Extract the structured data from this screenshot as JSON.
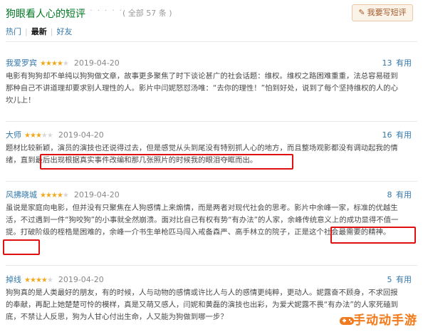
{
  "header": {
    "title": "狗眼看人心的短评",
    "dots": "· · · · · ·",
    "count": "( 全部 57 条 )",
    "write_label": "我要写短评",
    "pencil_icon": "pencil-icon"
  },
  "tabs": [
    {
      "label": "热门",
      "active": false
    },
    {
      "label": "最新",
      "active": true
    },
    {
      "label": "好友",
      "active": false
    }
  ],
  "star_color": "#f0a91b",
  "reviews": [
    {
      "user": "我爱罗宾",
      "rating": 4,
      "date": "2019-04-20",
      "votes": "13",
      "useful_label": "有用",
      "text": "电影有狗狗却不单纯以狗狗做文章，故事更多聚焦了时下谈论甚广的社会话题：维权。维权之路困难重重，法总容易碰到那种自己不讲道理却要求别人理性的人。影片中闫妮怒怼汤唯：“去你的理性！”怕到好处，说到了每个坚持维权的人的心坎儿上！"
    },
    {
      "user": "大师",
      "rating": 3,
      "date": "2019-04-20",
      "votes": "16",
      "useful_label": "有用",
      "text": "题材比较新颖，演员的演技也还说得过去，但是感觉从头到尾没有特别抓人心的地方，而且整场观影都没有调动起我的情绪，直到最后出现根据真实事件改编和那几张照片的时候我的眼泪夺眶而出。"
    },
    {
      "user": "风拂晓城",
      "rating": 4,
      "date": "2019-04-20",
      "votes": "8",
      "useful_label": "有用",
      "text": "虽说是家庭向电影，但并没有只聚焦在人狗感情上来煽情，而是两者对现代社会的思考。影片中余峰一家，标准的优越生活，不过遇到一件“狗咬狗”的小事就全然崩溃。面对比自己有权有势“有办法”的人家，余峰传统意义上的成功显得不值一提。打破阶级的桎梏是困难的，余峰一介书生单枪匹马闯入戒备森严、高手林立的院子，正是这个社会最需要的精神。"
    },
    {
      "user": "掉线",
      "rating": 4,
      "date": "2019-04-20",
      "votes": "5",
      "useful_label": "有用",
      "text": "狗狗真的是人类最好的朋友，有的时候，人与动物的感情或许比人与人的感情更纯粹，更动人。妮露奋不顾身，不求回报的奉献，再配上她楚楚可怜的模样，真是又萌又感人，闫妮和黄磊的演技也出彩，为爱犬妮露不畏“有办法”的人家死磕到底，不禁让人反思，狗为人甘心付出生命，人又能为狗做到哪一步？"
    }
  ],
  "watermark": {
    "text": "手动动手游",
    "icon": "gamepad-icon"
  },
  "highlight_color": "#e01010"
}
